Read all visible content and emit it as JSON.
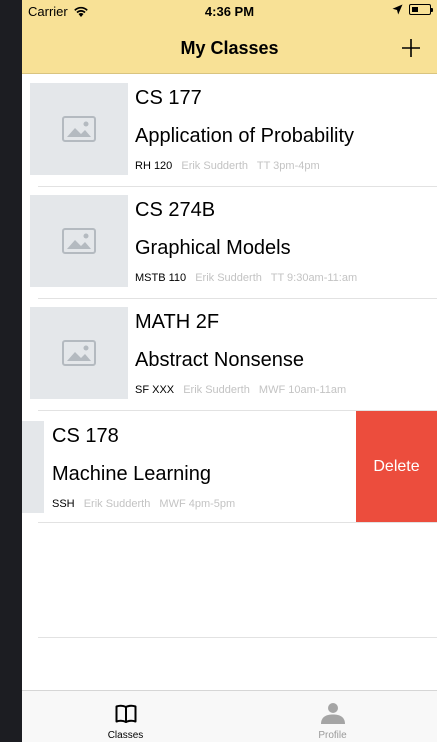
{
  "status_bar": {
    "carrier": "Carrier",
    "time": "4:36 PM"
  },
  "header": {
    "title": "My Classes",
    "add_icon": "plus-icon"
  },
  "classes": [
    {
      "code": "CS 177",
      "name": "Application of Probability",
      "room": "RH 120",
      "instructor": "Erik Sudderth",
      "schedule": "TT 3pm-4pm"
    },
    {
      "code": "CS 274B",
      "name": "Graphical Models",
      "room": "MSTB 110",
      "instructor": "Erik Sudderth",
      "schedule": "TT 9:30am-11:am"
    },
    {
      "code": "MATH 2F",
      "name": "Abstract Nonsense",
      "room": "SF XXX",
      "instructor": "Erik Sudderth",
      "schedule": "MWF 10am-11am"
    },
    {
      "code": "CS 178",
      "name": "Machine Learning",
      "room": "SSH",
      "instructor": "Erik Sudderth",
      "schedule": "MWF 4pm-5pm"
    }
  ],
  "swipe_action": {
    "delete_label": "Delete",
    "color": "#ec4d3d"
  },
  "tab_bar": {
    "tabs": [
      {
        "label": "Classes",
        "icon": "book-icon",
        "selected": true
      },
      {
        "label": "Profile",
        "icon": "person-icon",
        "selected": false
      }
    ]
  },
  "colors": {
    "nav_background": "#f8e196",
    "delete": "#ec4d3d",
    "secondary_text": "#c3c3c3"
  }
}
